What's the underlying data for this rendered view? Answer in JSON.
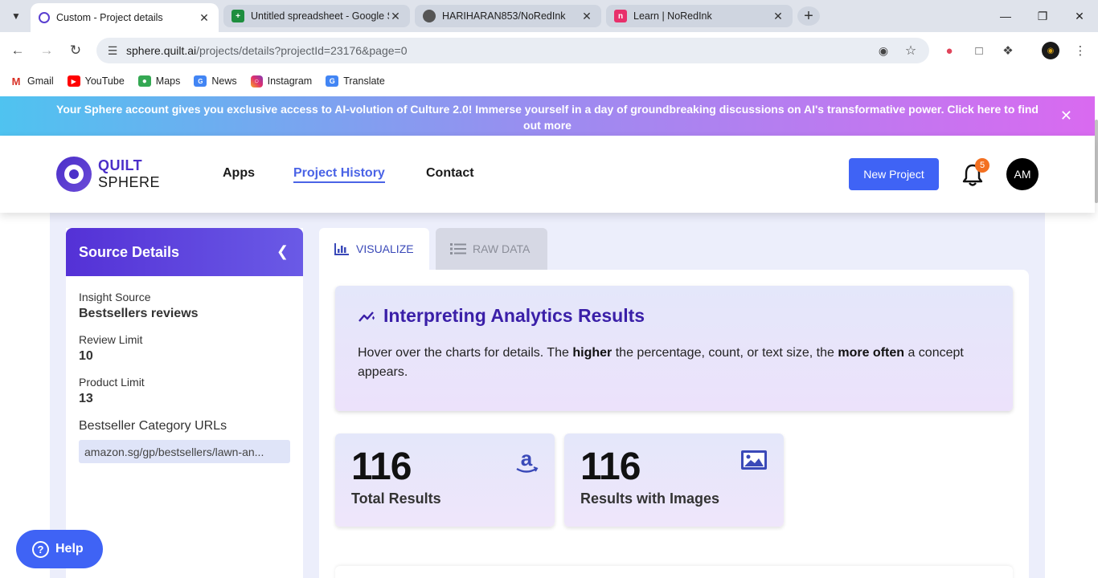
{
  "browser": {
    "tabs": [
      {
        "title": "Custom - Project details",
        "icon": "quilt-favicon",
        "active": true
      },
      {
        "title": "Untitled spreadsheet - Google S",
        "icon": "sheets-favicon",
        "active": false
      },
      {
        "title": "HARIHARAN853/NoRedInk",
        "icon": "github-favicon",
        "active": false
      },
      {
        "title": "Learn | NoRedInk",
        "icon": "noredink-favicon",
        "active": false
      }
    ],
    "url_host": "sphere.quilt.ai",
    "url_path": "/projects/details?projectId=23176&page=0",
    "bookmarks": [
      {
        "label": "Gmail",
        "icon": "gmail-icon"
      },
      {
        "label": "YouTube",
        "icon": "youtube-icon"
      },
      {
        "label": "Maps",
        "icon": "maps-icon"
      },
      {
        "label": "News",
        "icon": "news-icon"
      },
      {
        "label": "Instagram",
        "icon": "instagram-icon"
      },
      {
        "label": "Translate",
        "icon": "translate-icon"
      }
    ]
  },
  "promo": {
    "text": "Your Sphere account gives you exclusive access to AI-volution of Culture 2.0! Immerse yourself in a day of groundbreaking discussions on AI's transformative power. Click here to find out more"
  },
  "header": {
    "logo_line1": "QUILT",
    "logo_line2": "SPHERE",
    "nav": [
      "Apps",
      "Project History",
      "Contact"
    ],
    "new_project": "New Project",
    "notification_count": "5",
    "avatar_initials": "AM"
  },
  "source": {
    "title": "Source Details",
    "fields": [
      {
        "label": "Insight Source",
        "value": "Bestsellers reviews"
      },
      {
        "label": "Review Limit",
        "value": "10"
      },
      {
        "label": "Product Limit",
        "value": "13"
      }
    ],
    "urls_label": "Bestseller Category URLs",
    "url": "amazon.sg/gp/bestsellers/lawn-an..."
  },
  "view_tabs": {
    "visualize": "VISUALIZE",
    "raw": "RAW DATA"
  },
  "interpreting": {
    "title": "Interpreting Analytics Results",
    "text_1": "Hover over the charts for details. The ",
    "bold_1": "higher",
    "text_2": " the percentage, count, or text size, the ",
    "bold_2": "more often",
    "text_3": " a concept appears."
  },
  "stats": [
    {
      "value": "116",
      "label": "Total Results",
      "icon": "amazon-icon"
    },
    {
      "value": "116",
      "label": "Results with Images",
      "icon": "image-icon"
    }
  ],
  "help": "Help",
  "colors": {
    "accent": "#3f63f5",
    "purple": "#5431d6",
    "badge": "#f37021"
  }
}
